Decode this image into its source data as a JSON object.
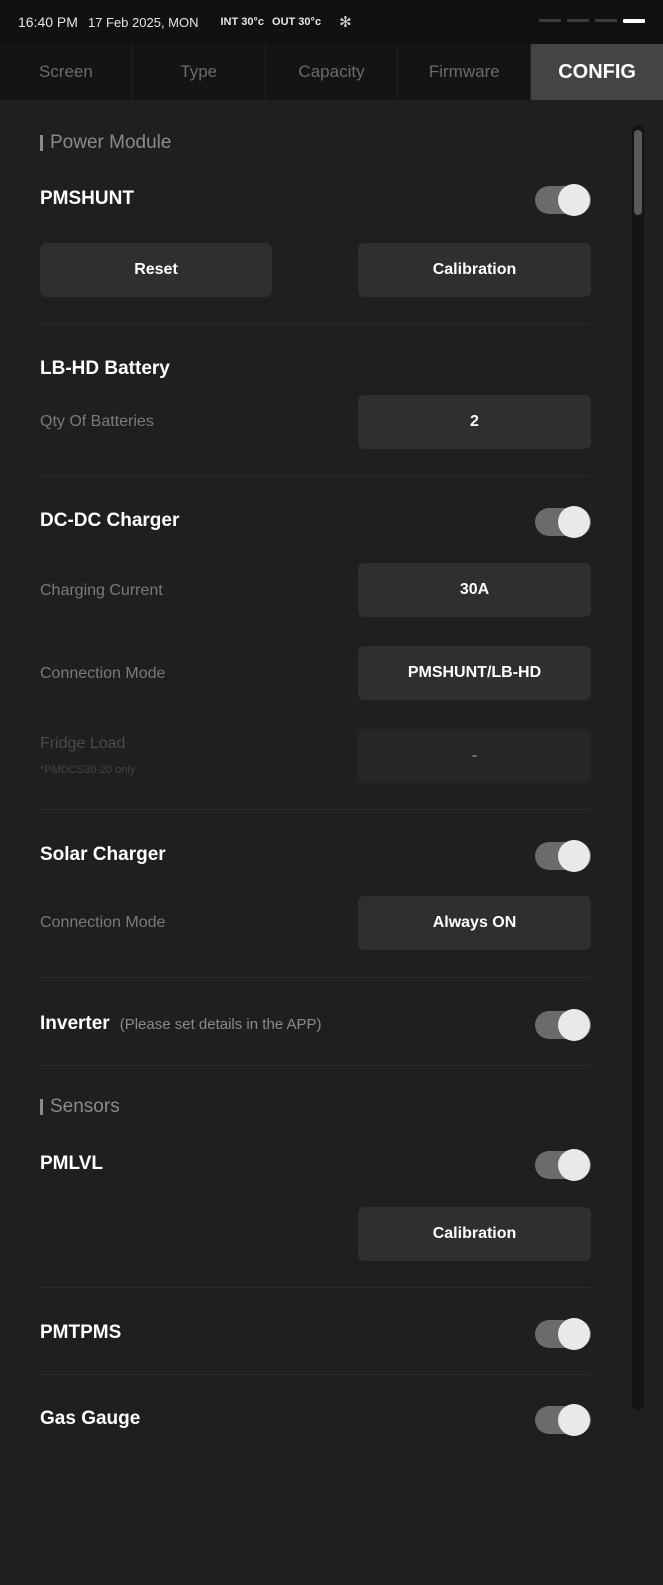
{
  "status": {
    "time": "16:40 PM",
    "date": "17 Feb 2025, MON",
    "int_temp": "INT 30°c",
    "out_temp": "OUT 30°c",
    "bluetooth_glyph": "✻"
  },
  "tabs": [
    "Screen",
    "Type",
    "Capacity",
    "Firmware",
    "CONFIG"
  ],
  "power_module": {
    "section_title": "Power Module",
    "pmshunt": {
      "title": "PMSHUNT",
      "enabled": true,
      "reset_label": "Reset",
      "calibration_label": "Calibration"
    },
    "lbhd": {
      "title": "LB-HD Battery",
      "qty_label": "Qty Of Batteries",
      "qty_value": "2"
    },
    "dcdc": {
      "title": "DC-DC Charger",
      "enabled": true,
      "current_label": "Charging Current",
      "current_value": "30A",
      "mode_label": "Connection Mode",
      "mode_value": "PMSHUNT/LB-HD",
      "fridge_label": "Fridge Load",
      "fridge_note": "*PMDCS30-20 only",
      "fridge_value": "-"
    },
    "solar": {
      "title": "Solar Charger",
      "enabled": true,
      "mode_label": "Connection Mode",
      "mode_value": "Always ON"
    },
    "inverter": {
      "title": "Inverter",
      "note": "(Please set details in the APP)",
      "enabled": true
    }
  },
  "sensors": {
    "section_title": "Sensors",
    "pmlvl": {
      "title": "PMLVL",
      "enabled": true,
      "calibration_label": "Calibration"
    },
    "pmtpms": {
      "title": "PMTPMS",
      "enabled": true
    },
    "gas_gauge": {
      "title": "Gas Gauge",
      "enabled": true
    }
  },
  "colors": {
    "background": "#1f1f1f",
    "tab_active": "#444444",
    "toggle_track": "#6b6b6b",
    "toggle_knob": "#e9e9e9"
  }
}
